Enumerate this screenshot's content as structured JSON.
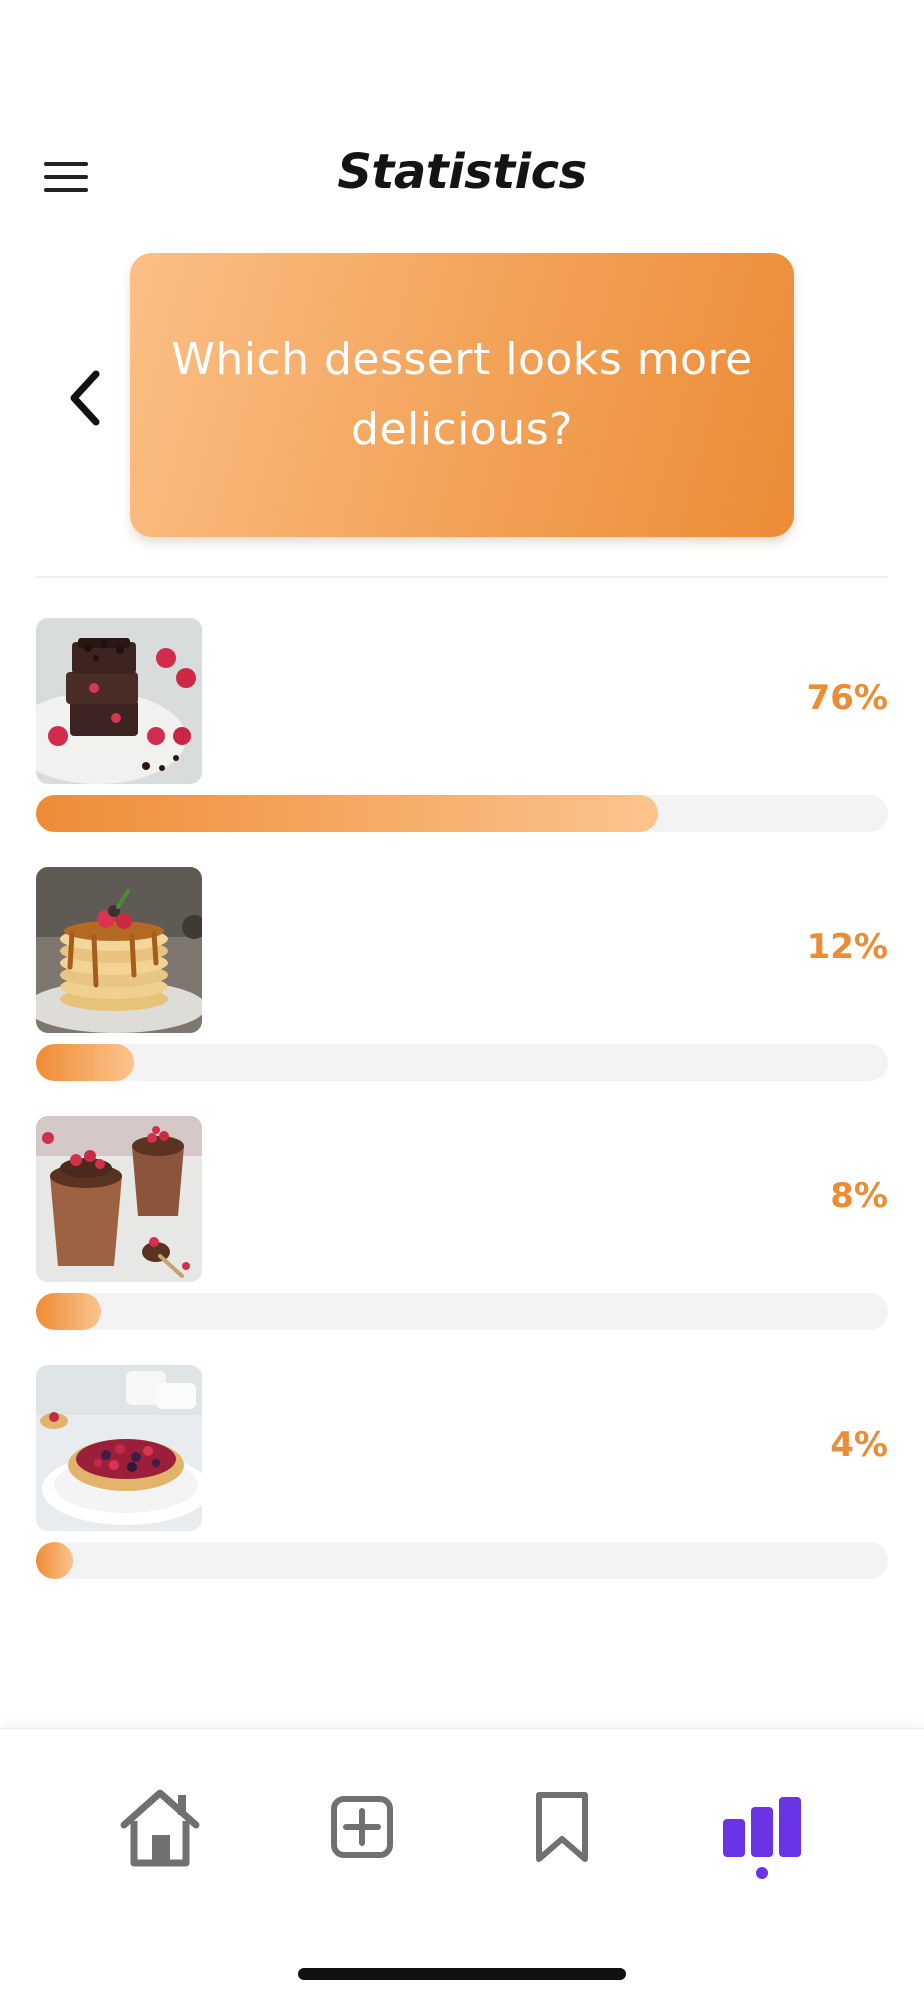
{
  "header": {
    "title": "Statistics",
    "menu_icon": "hamburger-menu-icon"
  },
  "question": {
    "prev_icon": "chevron-left-icon",
    "text": "Which dessert looks more delicious?"
  },
  "accent_colors": {
    "orange": "#ec8c34",
    "purple_active": "#6a34e6"
  },
  "results": [
    {
      "image": "chocolate-brownie-stack-with-raspberries-photo",
      "percent_label": "76%",
      "percent": 76
    },
    {
      "image": "pancake-stack-with-caramel-and-berries-photo",
      "percent_label": "12%",
      "percent": 12
    },
    {
      "image": "chocolate-mousse-cups-with-raspberries-photo",
      "percent_label": "8%",
      "percent": 8
    },
    {
      "image": "berry-tart-photo",
      "percent_label": "4%",
      "percent": 4
    }
  ],
  "tabbar": {
    "tabs": [
      {
        "icon": "home-icon",
        "active": false
      },
      {
        "icon": "add-square-icon",
        "active": false
      },
      {
        "icon": "bookmark-icon",
        "active": false
      },
      {
        "icon": "bar-chart-icon",
        "active": true
      }
    ]
  }
}
